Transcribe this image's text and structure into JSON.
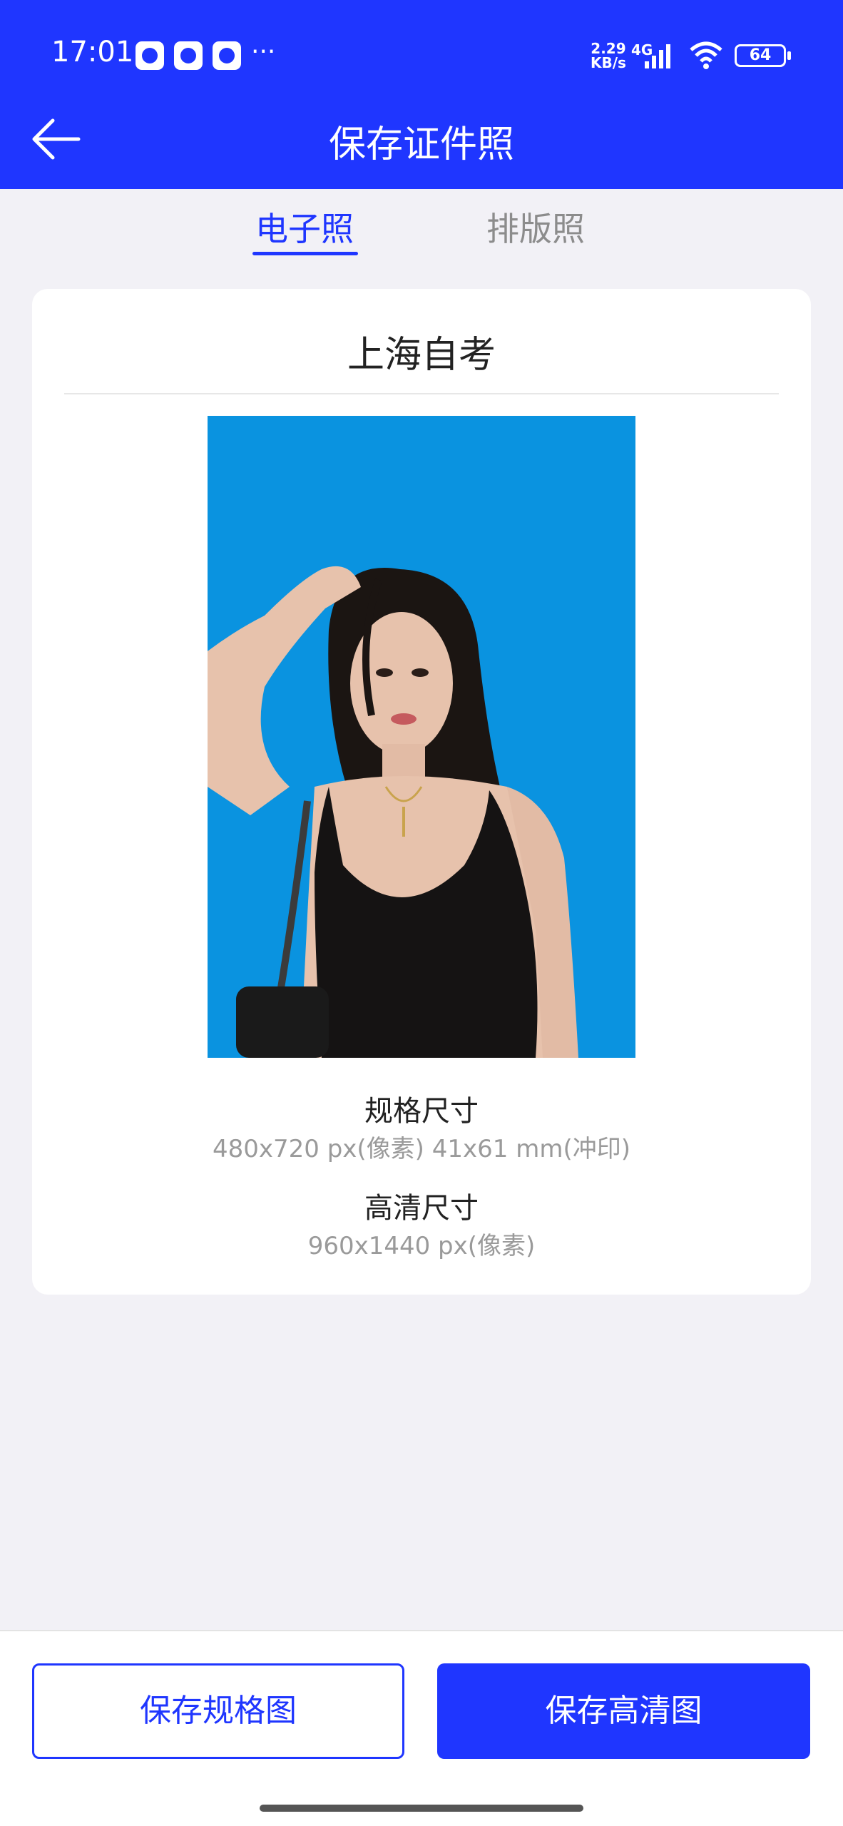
{
  "status_bar": {
    "time": "17:01",
    "net_speed_value": "2.29",
    "net_speed_unit": "KB/s",
    "network_type": "4G",
    "battery": "64",
    "more": "···"
  },
  "header": {
    "title": "保存证件照",
    "background_color": "#1f36ff"
  },
  "tabs": [
    {
      "label": "电子照",
      "active": true
    },
    {
      "label": "排版照",
      "active": false
    }
  ],
  "card": {
    "title": "上海自考",
    "photo_background_color": "#0a93e0",
    "spec": {
      "label": "规格尺寸",
      "value": "480x720 px(像素)   41x61 mm(冲印)"
    },
    "hd": {
      "label": "高清尺寸",
      "value": "960x1440 px(像素)"
    }
  },
  "buttons": {
    "save_spec": "保存规格图",
    "save_hd": "保存高清图"
  },
  "colors": {
    "accent": "#1f36ff",
    "page_background": "#f2f1f6"
  }
}
